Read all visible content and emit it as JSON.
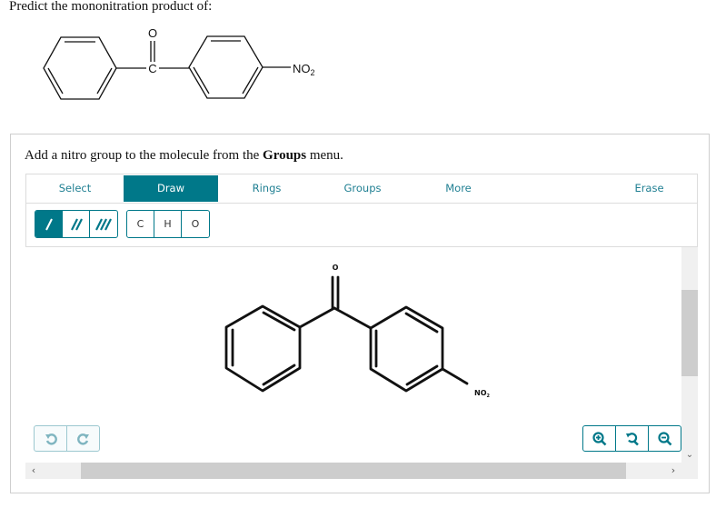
{
  "question": {
    "prompt": "Predict the mononitration product of:",
    "reactant": {
      "carbonyl_carbon_label": "C",
      "carbonyl_oxygen_label": "O",
      "substituent_label": "NO",
      "substituent_subscript": "2"
    }
  },
  "panel": {
    "instruction_prefix": "Add a nitro group to the molecule from the ",
    "instruction_bold": "Groups",
    "instruction_suffix": " menu.",
    "tabs": [
      {
        "label": "Select",
        "active": false
      },
      {
        "label": "Draw",
        "active": true
      },
      {
        "label": "Rings",
        "active": false
      },
      {
        "label": "Groups",
        "active": false
      },
      {
        "label": "More",
        "active": false
      },
      {
        "label": "Erase",
        "active": false
      }
    ],
    "bond_tools": [
      {
        "name": "single-bond",
        "glyph": "/",
        "active": true
      },
      {
        "name": "double-bond",
        "glyph": "//",
        "active": false
      },
      {
        "name": "triple-bond",
        "glyph": "///",
        "active": false
      }
    ],
    "atom_tools": [
      "C",
      "H",
      "O"
    ],
    "canvas_molecule": {
      "oxygen_label": "O",
      "substituent_label": "NO",
      "substituent_subscript": "2"
    },
    "undo_label": "undo",
    "redo_label": "redo",
    "zoom_in_label": "zoom in",
    "reset_label": "reset zoom",
    "zoom_out_label": "zoom out",
    "colors": {
      "accent": "#007889",
      "scroll_track": "#f0f0f0",
      "scroll_thumb": "#cdcdcd"
    }
  }
}
